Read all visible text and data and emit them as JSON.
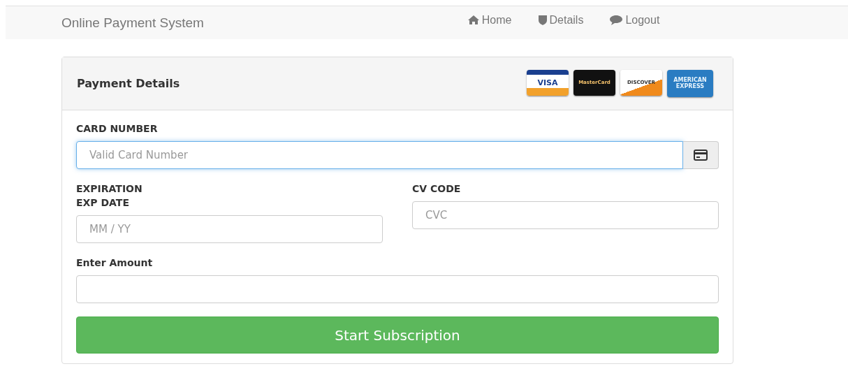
{
  "navbar": {
    "brand": "Online Payment System",
    "links": [
      {
        "label": "Home",
        "kind": "home"
      },
      {
        "label": "Details",
        "kind": "shield"
      },
      {
        "label": "Logout",
        "kind": "chat"
      }
    ]
  },
  "panel": {
    "title": "Payment Details",
    "cards": [
      {
        "kind": "visa",
        "label": "VISA"
      },
      {
        "kind": "mastercard",
        "label": "MasterCard"
      },
      {
        "kind": "discover",
        "label": "DISCOVER"
      },
      {
        "kind": "amex",
        "label": "AMERICAN EXPRESS"
      }
    ]
  },
  "card_number": {
    "label": "CARD NUMBER",
    "placeholder": "Valid Card Number",
    "focused": true
  },
  "expiration": {
    "heading": "EXPIRATION",
    "label": "EXP DATE",
    "placeholder": "MM / YY"
  },
  "cv_code": {
    "label": "CV CODE",
    "placeholder": "CVC"
  },
  "amount": {
    "label": "Enter Amount"
  },
  "submit": "Start Subscription"
}
